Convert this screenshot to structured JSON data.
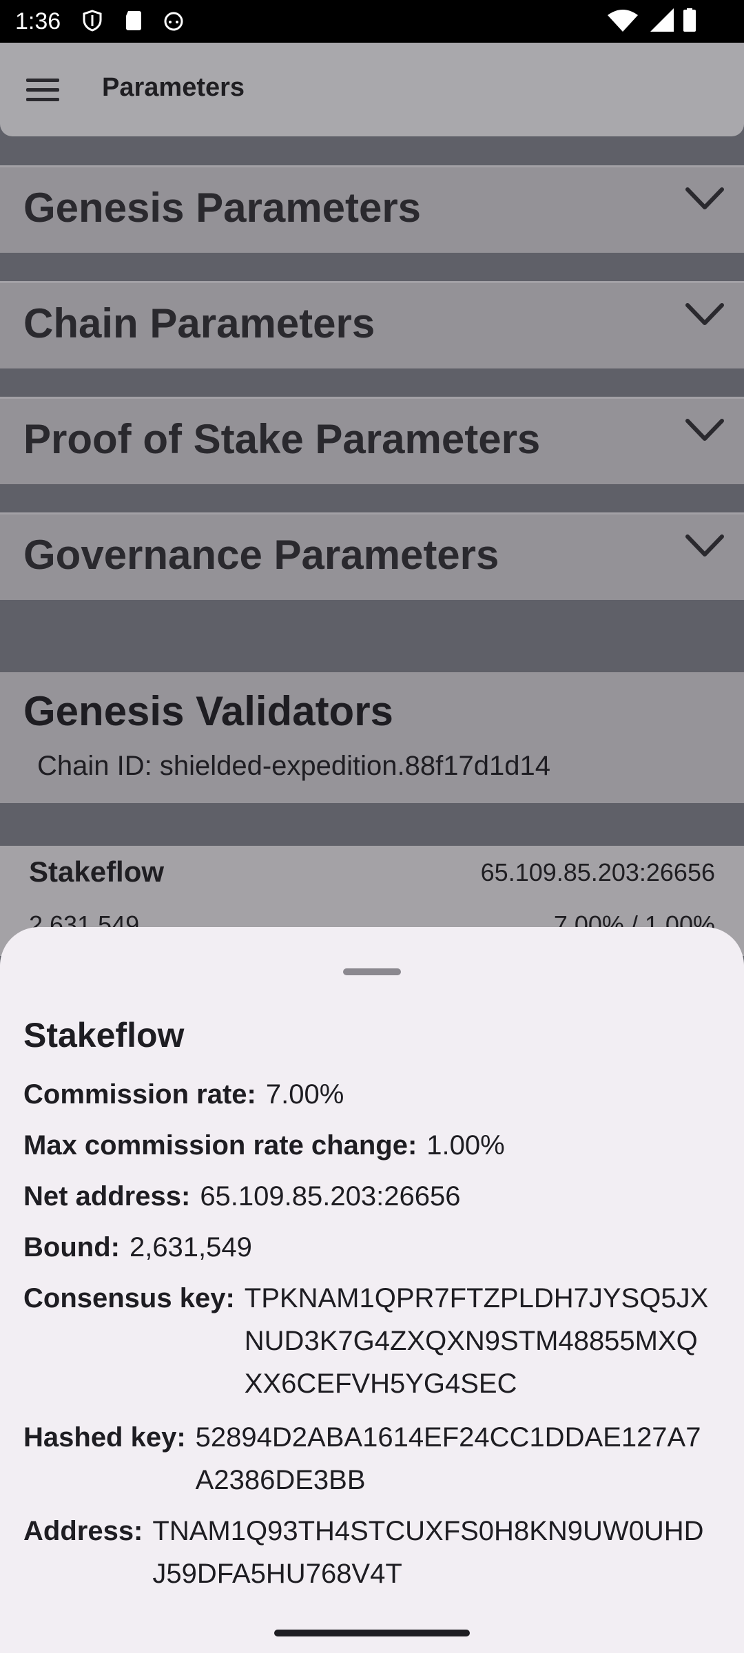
{
  "status_bar": {
    "time": "1:36",
    "left_icons": [
      "shield-icon",
      "sd-card-icon",
      "android-icon"
    ],
    "right_icons": [
      "wifi-icon",
      "signal-icon",
      "battery-icon"
    ]
  },
  "app_bar": {
    "menu_icon": "hamburger-icon",
    "title": "Parameters"
  },
  "sections": [
    {
      "label": "Genesis Parameters",
      "icon": "chevron-down-icon"
    },
    {
      "label": "Chain Parameters",
      "icon": "chevron-down-icon"
    },
    {
      "label": "Proof of Stake Parameters",
      "icon": "chevron-down-icon"
    },
    {
      "label": "Governance Parameters",
      "icon": "chevron-down-icon"
    }
  ],
  "validators_card": {
    "title": "Genesis Validators",
    "chain_id": "Chain ID: shielded-expedition.88f17d1d14"
  },
  "validator_row": {
    "name": "Stakeflow",
    "net_address": "65.109.85.203:26656",
    "bound": "2,631,549",
    "rates": "7.00% / 1.00%"
  },
  "sheet": {
    "title": "Stakeflow",
    "fields": [
      {
        "label": "Commission rate:",
        "value": "7.00%"
      },
      {
        "label": "Max commission rate change:",
        "value": "1.00%"
      },
      {
        "label": "Net address:",
        "value": "65.109.85.203:26656"
      },
      {
        "label": "Bound:",
        "value": "2,631,549"
      },
      {
        "label": "Consensus key:",
        "value": "TPKNAM1QPR7FTZPLDH7JYSQ5JXNUD3K7G4ZXQXN9STM48855MXQXX6CEFVH5YG4SEC"
      },
      {
        "label": "Hashed key:",
        "value": "52894D2ABA1614EF24CC1DDAE127A7A2386DE3BB"
      },
      {
        "label": "Address:",
        "value": "TNAM1Q93TH4STCUXFS0H8KN9UW0UHDJ59DFA5HU768V4T"
      }
    ]
  },
  "colors": {
    "scrim": "#5f6068",
    "sheet_bg": "#f2eef3",
    "text": "#1e1d22"
  }
}
